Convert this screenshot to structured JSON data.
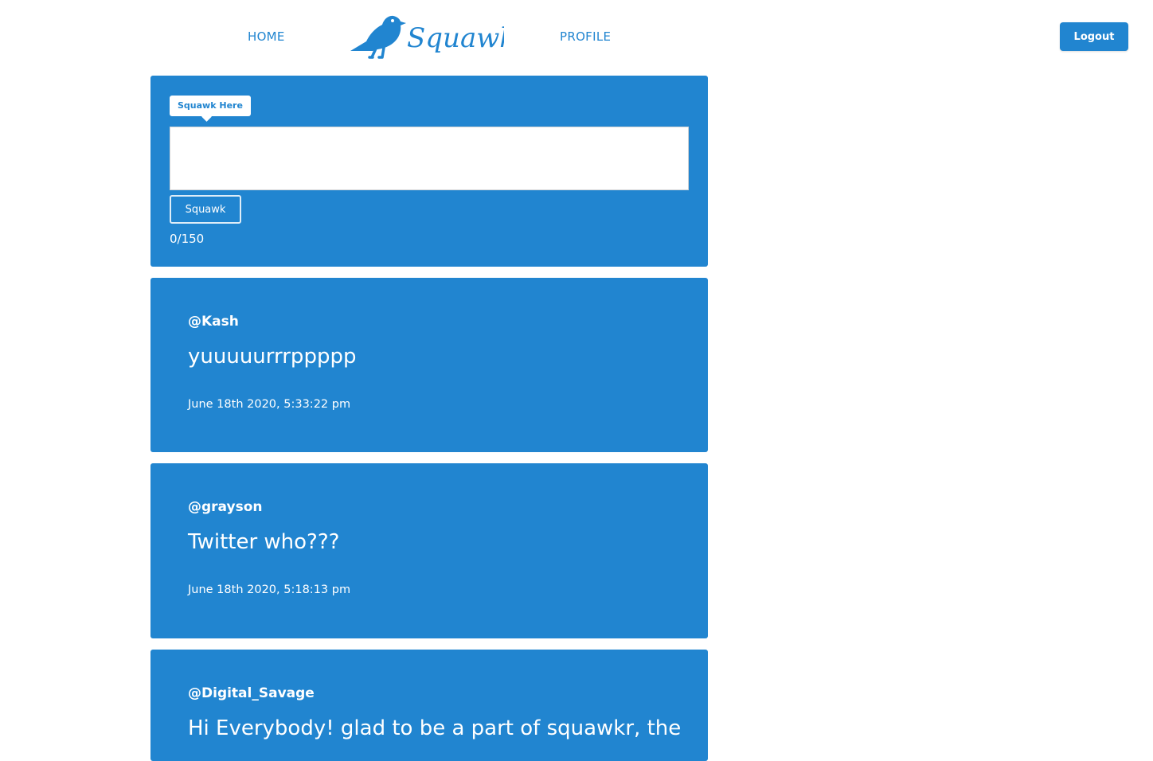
{
  "nav": {
    "home_label": "HOME",
    "profile_label": "PROFILE",
    "brand_name": "Squawkr",
    "logout_label": "Logout"
  },
  "compose": {
    "label": "Squawk Here",
    "input_value": "",
    "submit_label": "Squawk",
    "char_count": "0/150"
  },
  "posts": [
    {
      "user": "@Kash",
      "body": "yuuuuurrrppppp",
      "timestamp": "June 18th 2020, 5:33:22 pm"
    },
    {
      "user": "@grayson",
      "body": "Twitter who???",
      "timestamp": "June 18th 2020, 5:18:13 pm"
    },
    {
      "user": "@Digital_Savage",
      "body": "Hi Everybody! glad to be a part of squawkr, the",
      "timestamp": ""
    }
  ],
  "colors": {
    "primary": "#2185d0",
    "background": "#ffffff",
    "text_on_primary": "#ffffff"
  },
  "icons": {
    "brand_logo": "crow-icon"
  }
}
